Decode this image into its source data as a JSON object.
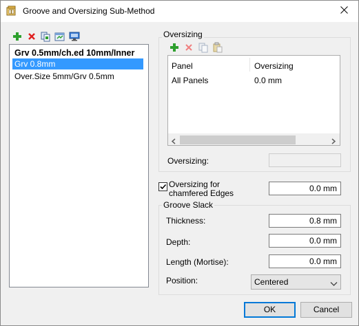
{
  "window": {
    "title": "Groove and Oversizing Sub-Method"
  },
  "toolbar": {
    "icons": [
      "add-icon",
      "delete-icon",
      "copy-icon",
      "edit-icon",
      "monitor-icon"
    ]
  },
  "methods_list": {
    "items": [
      {
        "label": "Grv 0.5mm/ch.ed 10mm/Inner",
        "bold": true,
        "selected": false
      },
      {
        "label": "Grv 0.8mm",
        "bold": false,
        "selected": true
      },
      {
        "label": "Over.Size 5mm/Grv 0.5mm",
        "bold": false,
        "selected": false
      }
    ]
  },
  "oversizing_group": {
    "label": "Oversizing",
    "toolbar_icons": [
      "add-icon",
      "delete-icon",
      "copy-icon",
      "paste-icon"
    ],
    "grid": {
      "columns": [
        "Panel",
        "Oversizing"
      ],
      "rows": [
        [
          "All Panels",
          "0.0 mm"
        ]
      ]
    },
    "field_label": "Oversizing:",
    "field_value": ""
  },
  "chamfer": {
    "checkbox_label": "Oversizing for chamfered Edges",
    "checked": true,
    "value": "0.0 mm"
  },
  "groove_slack": {
    "label": "Groove Slack",
    "thickness_label": "Thickness:",
    "thickness_value": "0.8 mm",
    "depth_label": "Depth:",
    "depth_value": "0.0 mm",
    "length_label": "Length (Mortise):",
    "length_value": "0.0 mm",
    "position_label": "Position:",
    "position_value": "Centered"
  },
  "buttons": {
    "ok": "OK",
    "cancel": "Cancel"
  },
  "colors": {
    "selection": "#3399ff",
    "default_button_border": "#0078d7",
    "add_green": "#2ea02e",
    "delete_red": "#e02020"
  }
}
